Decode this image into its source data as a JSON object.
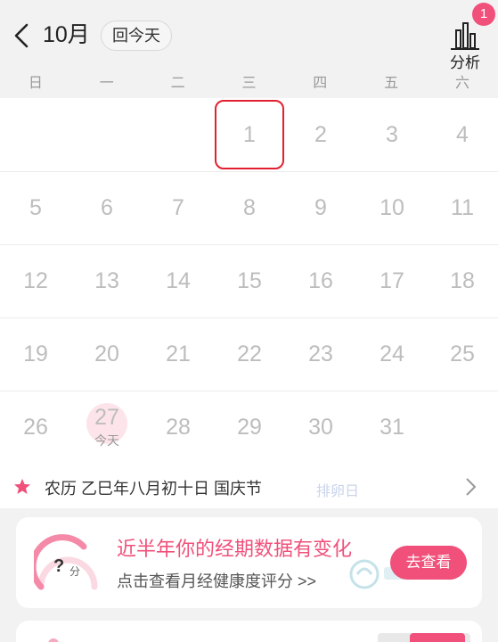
{
  "header": {
    "month": "10月",
    "today_button": "回今天",
    "analysis_label": "分析",
    "analysis_badge": "1"
  },
  "weekdays": [
    "日",
    "一",
    "二",
    "三",
    "四",
    "五",
    "六"
  ],
  "calendar": {
    "rows": [
      [
        "",
        "",
        "",
        "1",
        "2",
        "3",
        "4"
      ],
      [
        "5",
        "6",
        "7",
        "8",
        "9",
        "10",
        "11"
      ],
      [
        "12",
        "13",
        "14",
        "15",
        "16",
        "17",
        "18"
      ],
      [
        "19",
        "20",
        "21",
        "22",
        "23",
        "24",
        "25"
      ],
      [
        "26",
        "27",
        "28",
        "29",
        "30",
        "31",
        ""
      ]
    ],
    "selected_day": "1",
    "today_day": "27",
    "today_label": "今天"
  },
  "info_bar": {
    "lunar_text": "农历 乙巳年八月初十日 国庆节",
    "ghost_tag": "排卵日"
  },
  "card": {
    "gauge_value": "?",
    "gauge_unit": "分",
    "title": "近半年你的经期数据有变化",
    "subtitle": "点击查看月经健康度评分 >>",
    "button": "去查看"
  },
  "colors": {
    "accent": "#f0507a",
    "selected_border": "#e2202f",
    "today_bg": "#fde4ea"
  }
}
